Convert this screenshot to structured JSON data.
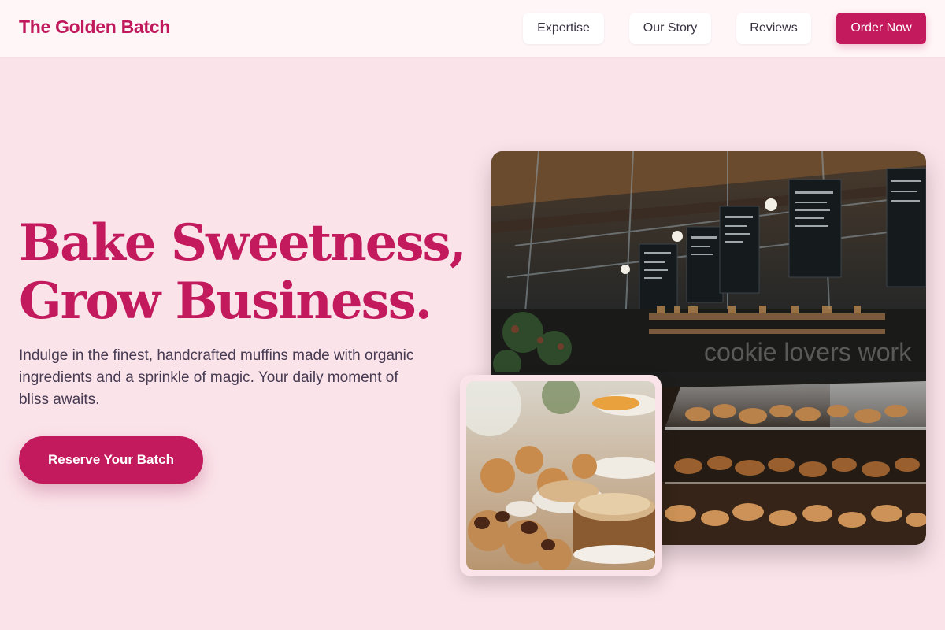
{
  "header": {
    "brand": "The Golden Batch",
    "nav": [
      {
        "label": "Expertise"
      },
      {
        "label": "Our Story"
      },
      {
        "label": "Reviews"
      }
    ],
    "order_label": "Order Now"
  },
  "hero": {
    "title_line1": "Bake Sweetness,",
    "title_line2": "Grow Business.",
    "description": "Indulge in the finest, handcrafted muffins made with organic ingredients and a sprinkle of magic. Your daily moment of bliss awaits.",
    "cta_label": "Reserve Your Batch",
    "main_photo_watermark": "cookie lovers work"
  },
  "colors": {
    "accent": "#c21a5c",
    "page_background": "#fbe3ea",
    "header_background": "#fff6f8"
  }
}
